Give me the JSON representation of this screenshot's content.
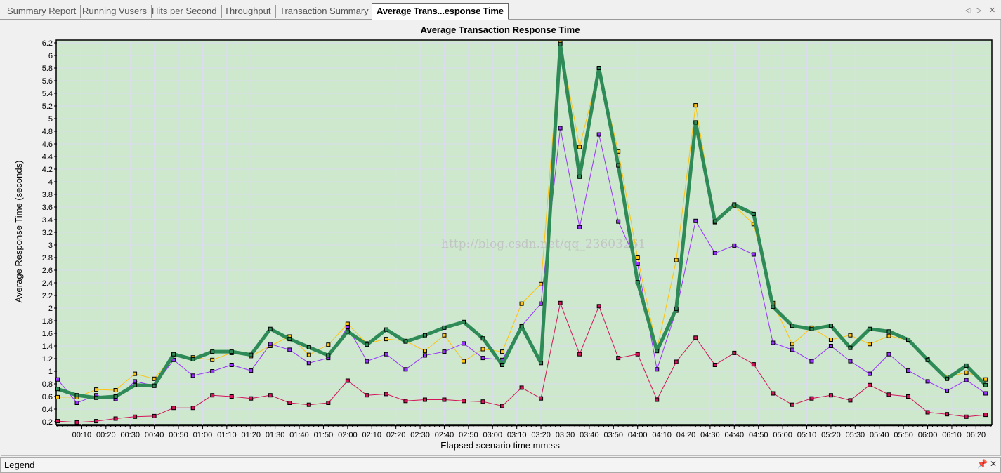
{
  "tabs": [
    {
      "label": "Summary Report",
      "active": false
    },
    {
      "label": "Running Vusers",
      "active": false
    },
    {
      "label": "Hits per Second",
      "active": false
    },
    {
      "label": "Throughput",
      "active": false
    },
    {
      "label": "Transaction Summary",
      "active": false
    },
    {
      "label": "Average Trans...esponse Time",
      "active": true
    }
  ],
  "tab_nav": {
    "prev_icon": "triangle-left-icon",
    "next_icon": "triangle-right-icon",
    "close_icon": "close-icon",
    "prev": "◁",
    "next": "▷",
    "close": "✕"
  },
  "watermark": "http://blog.csdn.net/qq_23603261",
  "legend": {
    "title": "Legend",
    "pin": "📌",
    "close": "✕",
    "pin_icon": "pin-icon",
    "close_icon": "close-icon"
  },
  "colors": {
    "plot_background": "#cde8cd",
    "grid": "#dcdcf0"
  },
  "chart_data": {
    "type": "line",
    "title": "Average Transaction Response Time",
    "xlabel": "Elapsed scenario time mm:ss",
    "ylabel": "Average Response Time (seconds)",
    "xlim": [
      0,
      386
    ],
    "ylim": [
      0.2,
      6.2
    ],
    "grid": true,
    "x_tick_labels": [
      "00:10",
      "00:20",
      "00:30",
      "00:40",
      "00:50",
      "01:00",
      "01:10",
      "01:20",
      "01:30",
      "01:40",
      "01:50",
      "02:00",
      "02:10",
      "02:20",
      "02:30",
      "02:40",
      "02:50",
      "03:00",
      "03:10",
      "03:20",
      "03:30",
      "03:40",
      "03:50",
      "04:00",
      "04:10",
      "04:20",
      "04:30",
      "04:40",
      "04:50",
      "05:00",
      "05:10",
      "05:20",
      "05:30",
      "05:40",
      "05:50",
      "06:00",
      "06:10",
      "06:20"
    ],
    "y_ticks": [
      0.2,
      0.4,
      0.6,
      0.8,
      1,
      1.2,
      1.4,
      1.6,
      1.8,
      2,
      2.2,
      2.4,
      2.6,
      2.8,
      3,
      3.2,
      3.4,
      3.6,
      3.8,
      4,
      4.2,
      4.4,
      4.6,
      4.8,
      5,
      5.2,
      5.4,
      5.6,
      5.8,
      6,
      6.2
    ],
    "x_seconds": [
      0,
      8,
      16,
      24,
      32,
      40,
      48,
      56,
      64,
      72,
      80,
      88,
      96,
      104,
      112,
      120,
      128,
      136,
      144,
      152,
      160,
      168,
      176,
      184,
      192,
      200,
      208,
      216,
      224,
      232,
      240,
      248,
      256,
      264,
      272,
      280,
      288,
      296,
      304,
      312,
      320,
      328,
      336,
      344,
      352,
      360,
      368,
      376,
      384
    ],
    "series": [
      {
        "color": "#ffc20e",
        "width": 1,
        "values": [
          0.59,
          0.59,
          0.71,
          0.7,
          0.96,
          0.88,
          1.26,
          1.22,
          1.18,
          1.29,
          1.24,
          1.4,
          1.55,
          1.26,
          1.42,
          1.75,
          1.44,
          1.51,
          1.48,
          1.32,
          1.57,
          1.16,
          1.35,
          1.31,
          2.07,
          2.38,
          6.2,
          4.55,
          5.78,
          4.48,
          2.8,
          1.35,
          2.76,
          5.21,
          3.36,
          3.62,
          3.33,
          2.08,
          1.43,
          1.69,
          1.5,
          1.57,
          1.43,
          1.56,
          1.49,
          1.19,
          0.91,
          0.98,
          0.87
        ]
      },
      {
        "color": "#9933ff",
        "width": 1,
        "values": [
          0.87,
          0.5,
          0.62,
          0.56,
          0.84,
          0.77,
          1.18,
          0.93,
          1.0,
          1.1,
          1.01,
          1.43,
          1.34,
          1.13,
          1.21,
          1.7,
          1.16,
          1.27,
          1.03,
          1.25,
          1.31,
          1.44,
          1.21,
          1.18,
          1.72,
          2.07,
          4.85,
          3.28,
          4.75,
          3.37,
          2.7,
          1.03,
          1.96,
          3.38,
          2.87,
          2.99,
          2.85,
          1.45,
          1.34,
          1.16,
          1.4,
          1.16,
          0.96,
          1.27,
          1.01,
          0.84,
          0.69,
          0.86,
          0.65
        ]
      },
      {
        "color": "#d4145a",
        "width": 1,
        "values": [
          0.21,
          0.19,
          0.21,
          0.25,
          0.28,
          0.29,
          0.42,
          0.42,
          0.62,
          0.6,
          0.57,
          0.62,
          0.5,
          0.47,
          0.5,
          0.85,
          0.62,
          0.64,
          0.53,
          0.55,
          0.55,
          0.53,
          0.52,
          0.45,
          0.74,
          0.57,
          2.08,
          1.27,
          2.03,
          1.21,
          1.27,
          0.55,
          1.15,
          1.53,
          1.1,
          1.29,
          1.11,
          0.65,
          0.47,
          0.57,
          0.62,
          0.54,
          0.78,
          0.63,
          0.6,
          0.35,
          0.32,
          0.28,
          0.31
        ]
      },
      {
        "color": "#2e8b57",
        "width": 5,
        "values": [
          0.72,
          0.62,
          0.58,
          0.6,
          0.78,
          0.77,
          1.27,
          1.19,
          1.31,
          1.31,
          1.26,
          1.67,
          1.51,
          1.38,
          1.25,
          1.63,
          1.42,
          1.66,
          1.47,
          1.57,
          1.69,
          1.78,
          1.52,
          1.1,
          1.71,
          1.13,
          6.18,
          4.08,
          5.8,
          4.26,
          2.41,
          1.32,
          1.99,
          4.94,
          3.37,
          3.64,
          3.49,
          2.02,
          1.72,
          1.67,
          1.72,
          1.37,
          1.67,
          1.63,
          1.5,
          1.18,
          0.88,
          1.09,
          0.78
        ]
      }
    ]
  }
}
